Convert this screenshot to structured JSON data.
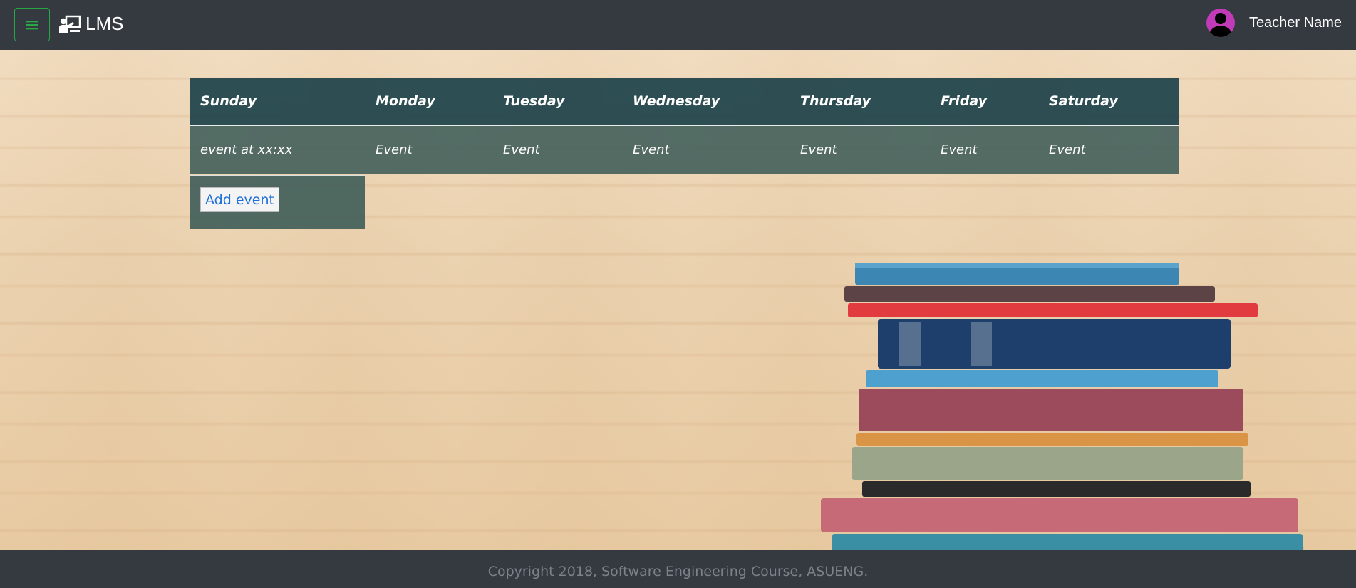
{
  "navbar": {
    "brand": "LMS",
    "user_name": "Teacher Name",
    "icons": {
      "menu": "hamburger-icon",
      "brand": "teacher-board-icon",
      "avatar": "user-avatar-icon"
    },
    "colors": {
      "background": "#343a40",
      "menu_accent": "#28a745",
      "avatar": "#c13bb8"
    }
  },
  "schedule": {
    "days": [
      "Sunday",
      "Monday",
      "Tuesday",
      "Wednesday",
      "Thursday",
      "Friday",
      "Saturday"
    ],
    "events": [
      "event at xx:xx",
      "Event",
      "Event",
      "Event",
      "Event",
      "Event",
      "Event"
    ],
    "add_button": "Add event"
  },
  "footer": {
    "copyright": "Copyright 2018, Software Engineering Course, ASUENG."
  }
}
